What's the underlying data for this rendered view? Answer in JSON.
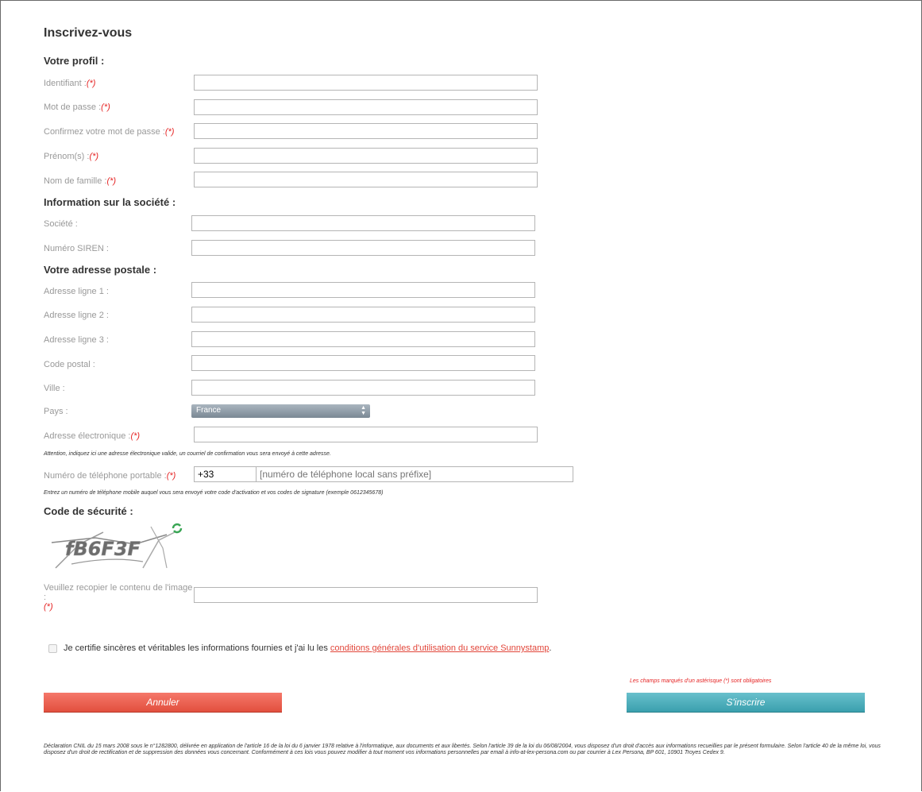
{
  "form": {
    "title": "Inscrivez-vous",
    "required_marker": "(*)",
    "sections": {
      "profile": "Votre profil :",
      "company": "Information sur la société :",
      "address": "Votre adresse postale :",
      "security": "Code de sécurité :"
    },
    "labels": {
      "identifiant": "Identifiant :",
      "password": "Mot de passe :",
      "password_confirm": "Confirmez votre mot de passe :",
      "firstname": "Prénom(s) :",
      "lastname": "Nom de famille :",
      "company": "Société :",
      "siren": "Numéro SIREN :",
      "address1": "Adresse ligne 1 :",
      "address2": "Adresse ligne 2 :",
      "address3": "Adresse ligne 3 :",
      "zip": "Code postal :",
      "city": "Ville :",
      "country": "Pays :",
      "email": "Adresse électronique :",
      "phone": "Numéro de téléphone portable :",
      "captcha": "Veuillez recopier le contenu de l'image :"
    },
    "country_selected": "France",
    "phone_prefix": "+33",
    "phone_placeholder": "[numéro de téléphone local sans préfixe]",
    "email_note": "Attention, indiquez ici une adresse électronique valide, un courriel de confirmation vous sera envoyé à cette adresse.",
    "phone_note": "Entrez un numéro de téléphone mobile auquel vous sera envoyé votre code d'activation et vos codes de signature (exemple 0612345678)",
    "captcha_text": "fB6F3F",
    "certify_text": "Je certifie sincères et véritables les informations fournies et j'ai lu les ",
    "certify_link": "conditions générales d'utilisation du service Sunnystamp",
    "certify_end": ".",
    "mandatory_note": "Les champs marqués d'un astérisque (*) sont obligatoires",
    "cancel_label": "Annuler",
    "submit_label": "S'inscrire",
    "footer": "Déclaration CNIL du 15 mars 2008 sous le n°1282800, délivrée en application de l'article 16 de la loi du 6 janvier 1978 relative à l'informatique, aux documents et aux libertés. Selon l'article 39 de la loi du 06/08/2004, vous disposez d'un droit d'accès aux informations recueillies par le présent formulaire. Selon l'article 40 de la même loi, vous disposez d'un droit de rectification et de suppression des données vous concernant. Conformément à ces lois vous pouvez modifier à tout moment vos informations personnelles par email à info-at-lex-persona.com ou par courrier à Lex Persona, BP 601, 10901 Troyes Cedex 9."
  }
}
